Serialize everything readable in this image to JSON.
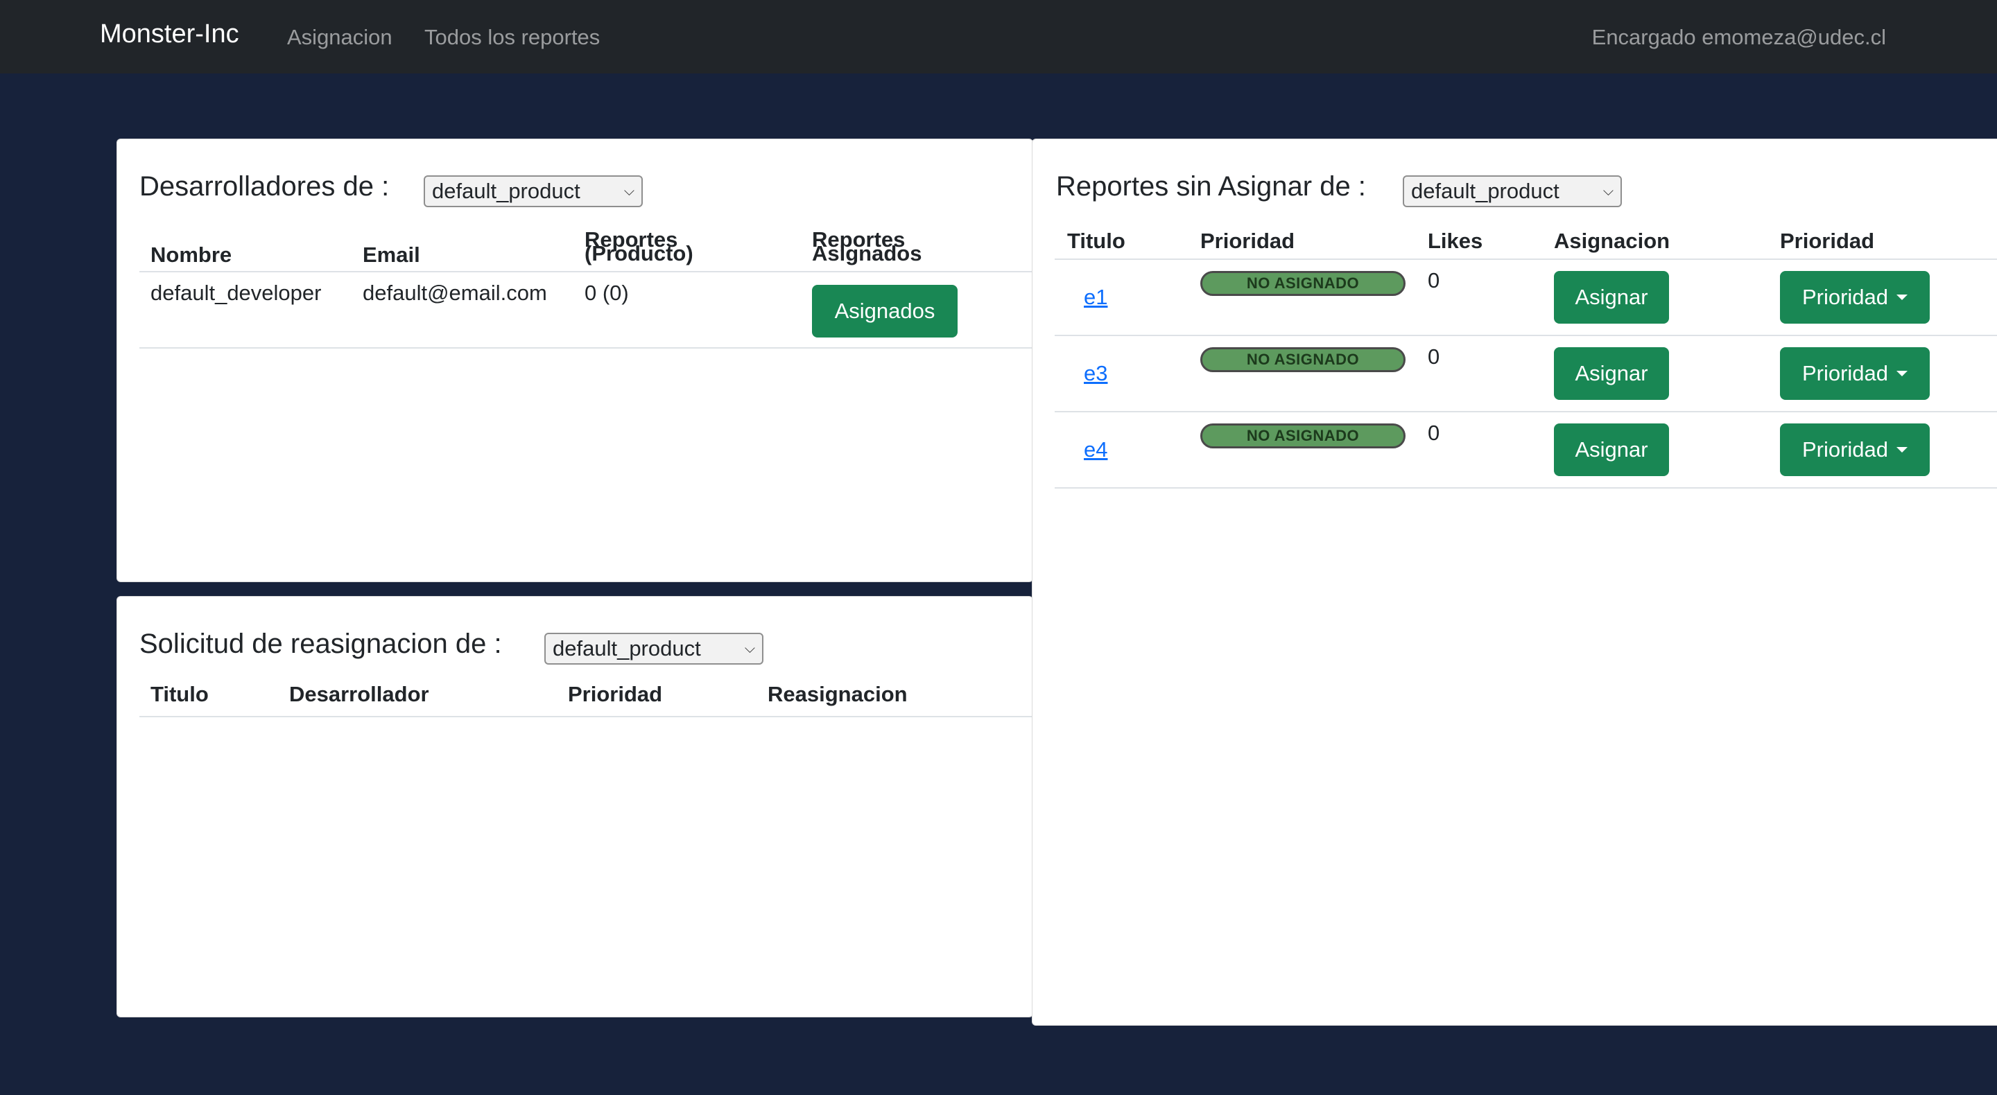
{
  "navbar": {
    "brand": "Monster-Inc",
    "links": [
      "Asignacion",
      "Todos los reportes"
    ],
    "user": "Encargado emomeza@udec.cl"
  },
  "developers": {
    "title": "Desarrolladores de :",
    "product": "default_product",
    "headers": [
      "Nombre",
      "Email",
      "Reportes",
      "(Producto)",
      "Reportes",
      "Asignados"
    ],
    "rows": [
      {
        "name": "default_developer",
        "email": "default@email.com",
        "reports": "0 (0)",
        "button": "Asignados"
      }
    ]
  },
  "reassign": {
    "title": "Solicitud de reasignacion de :",
    "product": "default_product",
    "headers": [
      "Titulo",
      "Desarrollador",
      "Prioridad",
      "Reasignacion"
    ]
  },
  "unassigned": {
    "title": "Reportes sin Asignar de :",
    "product": "default_product",
    "headers": [
      "Titulo",
      "Prioridad",
      "Likes",
      "Asignacion",
      "Prioridad"
    ],
    "rows": [
      {
        "title": "e1",
        "status": "NO ASIGNADO",
        "likes": "0",
        "assign": "Asignar",
        "priority": "Prioridad"
      },
      {
        "title": "e3",
        "status": "NO ASIGNADO",
        "likes": "0",
        "assign": "Asignar",
        "priority": "Prioridad"
      },
      {
        "title": "e4",
        "status": "NO ASIGNADO",
        "likes": "0",
        "assign": "Asignar",
        "priority": "Prioridad"
      }
    ]
  },
  "colors": {
    "page_bg": "#17223b",
    "navbar_bg": "#212529",
    "success": "#198754",
    "badge": "#5d9a5e",
    "link": "#0d6efd"
  }
}
